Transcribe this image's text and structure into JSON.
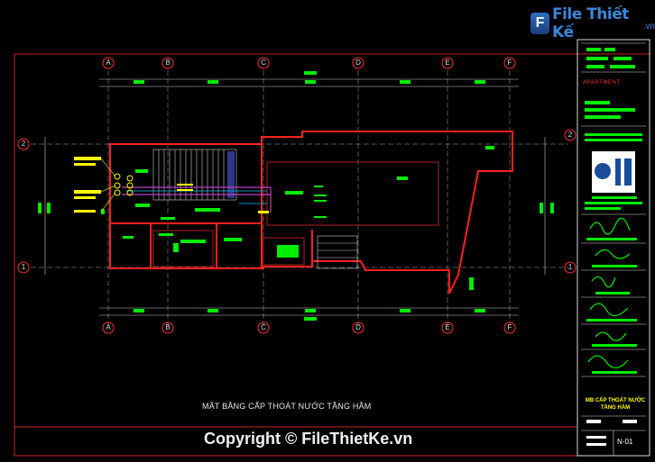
{
  "logo": {
    "badge": "F",
    "name": "File Thiết Kế",
    "suffix": ".vn"
  },
  "drawing": {
    "caption": "MẶT BẰNG CẤP THOÁT NƯỚC TẦNG HẦM",
    "grid_columns": [
      "A",
      "B",
      "C",
      "D",
      "E",
      "F"
    ],
    "grid_rows": [
      "2",
      "1"
    ]
  },
  "title_block": {
    "project": "APARTMENT",
    "sheet_title": "MB CẤP THOÁT NƯỚC TẦNG HẦM",
    "sheet_number": "N-01"
  },
  "watermark": {
    "copyright": "Copyright © FileThietKe.vn"
  },
  "colors": {
    "background": "#000000",
    "frame": "#ff2020",
    "annotation": "#00ff00",
    "wall": "#ff3333",
    "accent": "#ffff00"
  }
}
